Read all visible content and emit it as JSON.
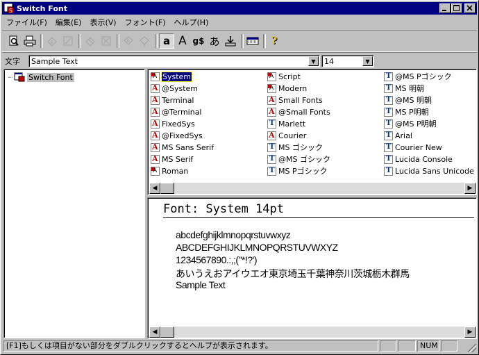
{
  "window": {
    "title": "Switch Font"
  },
  "menu": [
    "ファイル(F)",
    "編集(E)",
    "表示(V)",
    "フォント(F)",
    "ヘルプ(H)"
  ],
  "toolbar": {
    "buttons": [
      {
        "name": "preview-icon"
      },
      {
        "name": "print-icon"
      },
      {
        "name": "install-icon"
      },
      {
        "name": "uninstall-icon"
      },
      {
        "name": "move-icon"
      },
      {
        "name": "delete-icon"
      },
      {
        "name": "copy-icon"
      },
      {
        "name": "paste-icon"
      },
      {
        "name": "small-a-label",
        "text": "a"
      },
      {
        "name": "large-a-label",
        "text": "A"
      },
      {
        "name": "symbol-label",
        "text": "g$"
      },
      {
        "name": "hiragana-label",
        "text": "あ"
      },
      {
        "name": "download-icon"
      },
      {
        "name": "keyboard-icon"
      },
      {
        "name": "help-icon"
      }
    ]
  },
  "input": {
    "label": "文字",
    "sample_text": "Sample Text",
    "size": "14"
  },
  "tree": {
    "root": "Switch Font"
  },
  "fonts": {
    "col1": [
      {
        "name": "System",
        "type": "s",
        "selected": true
      },
      {
        "name": "@System",
        "type": "a"
      },
      {
        "name": "Terminal",
        "type": "a"
      },
      {
        "name": "@Terminal",
        "type": "a"
      },
      {
        "name": "FixedSys",
        "type": "a"
      },
      {
        "name": "@FixedSys",
        "type": "a"
      },
      {
        "name": "MS Sans Serif",
        "type": "a"
      },
      {
        "name": "MS Serif",
        "type": "a"
      },
      {
        "name": "Roman",
        "type": "s"
      }
    ],
    "col2": [
      {
        "name": "Script",
        "type": "s"
      },
      {
        "name": "Modern",
        "type": "s"
      },
      {
        "name": "Small Fonts",
        "type": "a"
      },
      {
        "name": "@Small Fonts",
        "type": "a"
      },
      {
        "name": "Marlett",
        "type": "t"
      },
      {
        "name": "Courier",
        "type": "a"
      },
      {
        "name": "MS ゴシック",
        "type": "t"
      },
      {
        "name": "@MS ゴシック",
        "type": "t"
      },
      {
        "name": "MS Pゴシック",
        "type": "t"
      }
    ],
    "col3": [
      {
        "name": "@MS Pゴシック",
        "type": "t"
      },
      {
        "name": "MS 明朝",
        "type": "t"
      },
      {
        "name": "@MS 明朝",
        "type": "t"
      },
      {
        "name": "MS P明朝",
        "type": "t"
      },
      {
        "name": "@MS P明朝",
        "type": "t"
      },
      {
        "name": "Arial",
        "type": "t"
      },
      {
        "name": "Courier New",
        "type": "t"
      },
      {
        "name": "Lucida Console",
        "type": "t"
      },
      {
        "name": "Lucida Sans Unicode",
        "type": "t"
      }
    ]
  },
  "preview": {
    "heading": "Font: System 14pt",
    "lines": [
      "abcdefghijklmnopqrstuvwxyz",
      "ABCDEFGHIJKLMNOPQRSTUVWXYZ",
      "1234567890.:,;(\"*!?')",
      "あいうえおアイウエオ東京埼玉千葉神奈川茨城栃木群馬",
      "Sample Text"
    ]
  },
  "status": {
    "message": "[F1]もしくは項目がない部分をダブルクリックするとヘルプが表示されます。",
    "num": "NUM"
  },
  "colors": {
    "titlebar": "#000080",
    "face": "#c0c0c0",
    "selection": "#000080"
  }
}
